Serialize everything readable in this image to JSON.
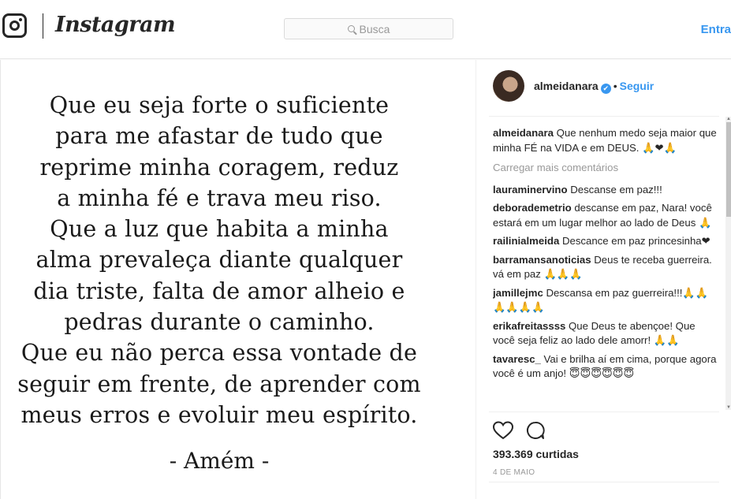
{
  "header": {
    "brand": "Instagram",
    "search_placeholder": "Busca",
    "login_label": "Entra"
  },
  "photo": {
    "quote_lines": [
      "Que eu seja forte o suficiente",
      "para me afastar de tudo que",
      "reprime minha coragem, reduz",
      "a minha fé e trava meu riso.",
      "Que a luz que habita a minha",
      "alma prevaleça diante qualquer",
      "dia triste, falta de amor alheio e",
      "pedras durante o caminho.",
      "Que eu não perca essa vontade de",
      "seguir em frente, de aprender com",
      "meus erros e evoluir meu espírito."
    ],
    "amen": "- Amém -"
  },
  "post": {
    "username": "almeidanara",
    "verified_mark": "✔",
    "separator": "•",
    "follow_label": "Seguir",
    "caption_user": "almeidanara",
    "caption_text": " Que nenhum medo seja maior que minha FÉ na VIDA e em DEUS. 🙏❤🙏",
    "load_more": "Carregar mais comentários",
    "comments": [
      {
        "user": "lauraminervino",
        "text": " Descanse em paz!!!"
      },
      {
        "user": "deborademetrio",
        "text": " descanse em paz, Nara! você estará em um lugar melhor ao lado de Deus 🙏"
      },
      {
        "user": "railinialmeida",
        "text": " Descance em paz princesinha❤"
      },
      {
        "user": "barramansanoticias",
        "text": " Deus te receba guerreira. vá em paz 🙏🙏🙏"
      },
      {
        "user": "jamillejmc",
        "text": " Descansa em paz guerreira!!!🙏🙏🙏🙏🙏🙏"
      },
      {
        "user": "erikafreitassss",
        "text": " Que Deus te abençoe! Que você seja feliz ao lado dele amorr! 🙏🙏"
      },
      {
        "user": "tavaresc_",
        "text": " Vai e brilha aí em cima, porque agora você é um anjo! 😇😇😇😇😇😇"
      }
    ],
    "likes": "393.369 curtidas",
    "date": "4 DE MAIO"
  },
  "colors": {
    "accent": "#3897f0",
    "text": "#262626",
    "muted": "#999999"
  }
}
